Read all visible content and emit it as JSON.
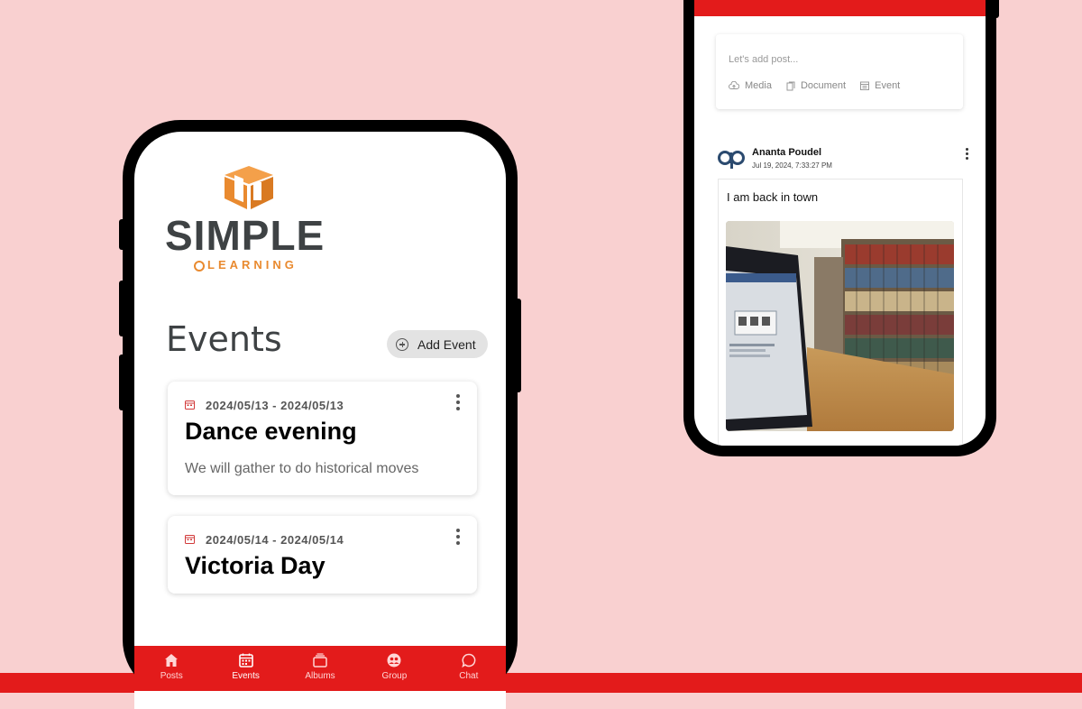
{
  "colors": {
    "background": "#f9d0d0",
    "brand_red": "#e31b1b",
    "logo_orange": "#e98a2f",
    "logo_gray": "#3e4244"
  },
  "logo": {
    "word": "SIMPLE",
    "sub": "LEARNING"
  },
  "events_page": {
    "title": "Events",
    "add_button_label": "Add Event",
    "events": [
      {
        "date": "2024/05/13 - 2024/05/13",
        "title": "Dance evening",
        "description": "We will gather to do historical moves"
      },
      {
        "date": "2024/05/14 - 2024/05/14",
        "title": "Victoria Day",
        "description": ""
      }
    ]
  },
  "tabbar": [
    {
      "label": "Posts",
      "icon": "home-icon",
      "active": false
    },
    {
      "label": "Events",
      "icon": "calendar-icon",
      "active": true
    },
    {
      "label": "Albums",
      "icon": "album-icon",
      "active": false
    },
    {
      "label": "Group",
      "icon": "group-icon",
      "active": false
    },
    {
      "label": "Chat",
      "icon": "chat-icon",
      "active": false
    }
  ],
  "feed": {
    "composer": {
      "placeholder": "Let's add post...",
      "options": [
        {
          "label": "Media",
          "icon": "cloud-upload-icon"
        },
        {
          "label": "Document",
          "icon": "document-icon"
        },
        {
          "label": "Event",
          "icon": "calendar-icon"
        }
      ]
    },
    "post": {
      "author": "Ananta Poudel",
      "timestamp": "Jul 19, 2024, 7:33:27 PM",
      "text": "I am back in town"
    }
  }
}
